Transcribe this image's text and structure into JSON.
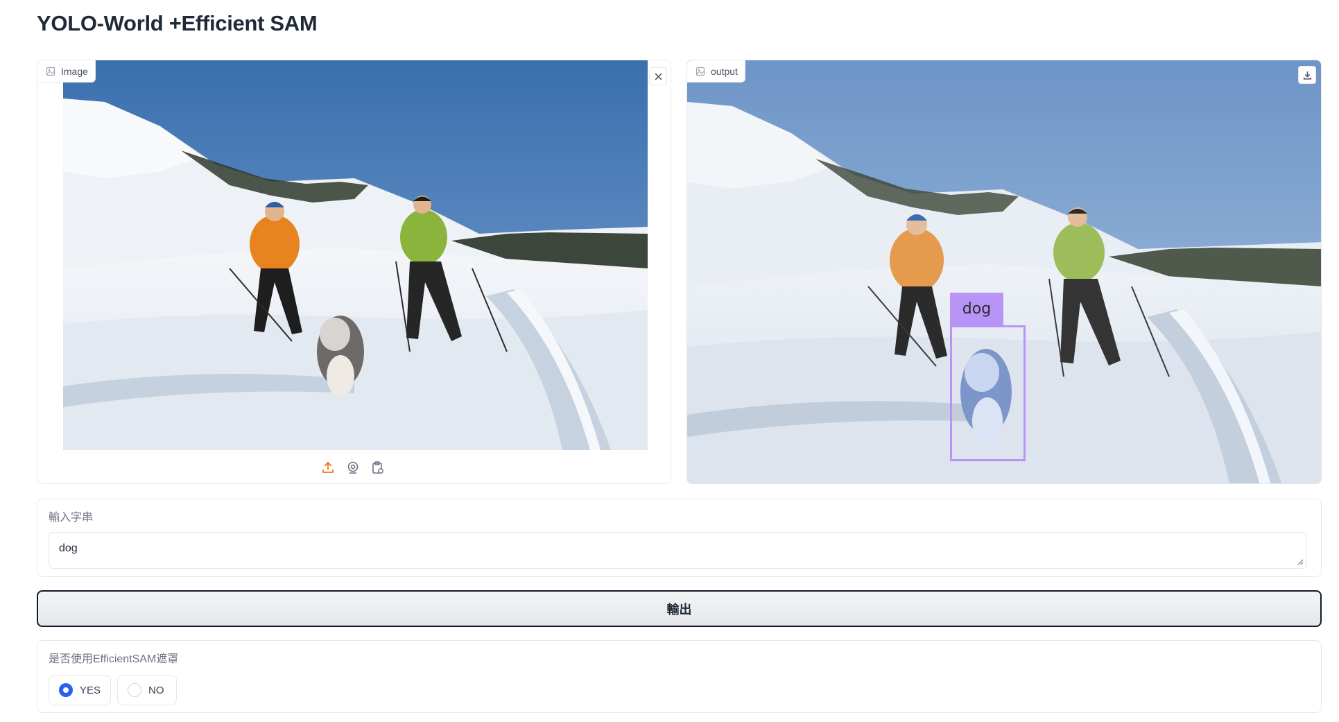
{
  "app": {
    "title": "YOLO-World +Efficient SAM"
  },
  "input_image": {
    "label": "Image",
    "clear_icon": "close-icon",
    "sources": [
      "upload-icon",
      "webcam-icon",
      "clipboard-icon"
    ]
  },
  "output_image": {
    "label": "output",
    "download_icon": "download-icon",
    "detection": {
      "label": "dog",
      "color": "#b794f6"
    }
  },
  "prompt": {
    "label": "輸入字串",
    "value": "dog"
  },
  "submit": {
    "label": "輸出"
  },
  "mask_option": {
    "label": "是否使用EfficientSAM遮罩",
    "options": [
      {
        "label": "YES",
        "selected": true
      },
      {
        "label": "NO",
        "selected": false
      }
    ]
  },
  "colors": {
    "accent": "#2563eb",
    "upload": "#f97316",
    "box": "#b794f6"
  }
}
